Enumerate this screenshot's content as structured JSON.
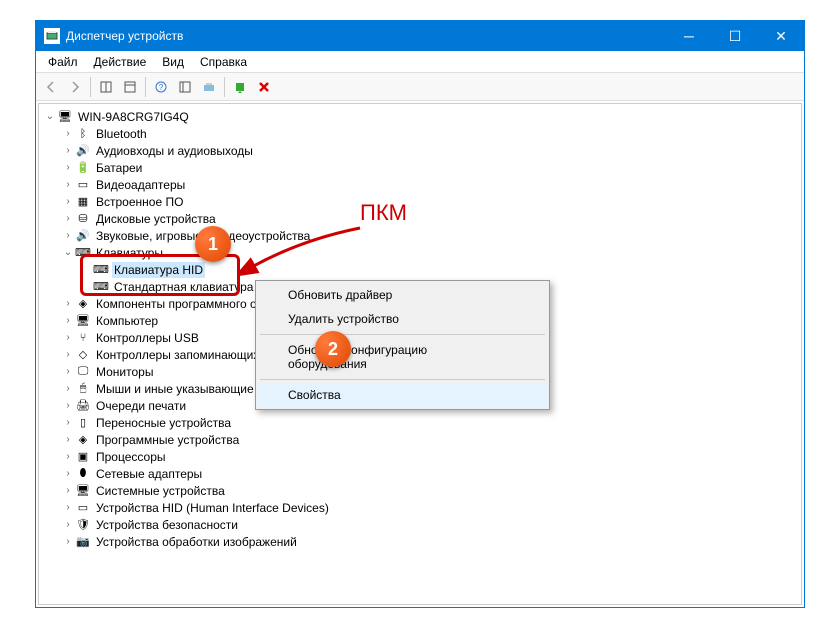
{
  "window": {
    "title": "Диспетчер устройств"
  },
  "menubar": {
    "file": "Файл",
    "action": "Действие",
    "view": "Вид",
    "help": "Справка"
  },
  "tree": {
    "root": "WIN-9A8CRG7IG4Q",
    "items": [
      "Bluetooth",
      "Аудиовходы и аудиовыходы",
      "Батареи",
      "Видеоадаптеры",
      "Встроенное ПО",
      "Дисковые устройства",
      "Звуковые, игровые и видеоустройства",
      "Клавиатуры",
      "Клавиатура HID",
      "Стандартная клавиатура",
      "Компоненты программного обеспечения",
      "Компьютер",
      "Контроллеры USB",
      "Контроллеры запоминающих устройств",
      "Мониторы",
      "Мыши и иные указывающие устройства",
      "Очереди печати",
      "Переносные устройства",
      "Программные устройства",
      "Процессоры",
      "Сетевые адаптеры",
      "Системные устройства",
      "Устройства HID (Human Interface Devices)",
      "Устройства безопасности",
      "Устройства обработки изображений"
    ]
  },
  "context_menu": {
    "update_driver": "Обновить драйвер",
    "uninstall": "Удалить устройство",
    "scan": "Обновить конфигурацию оборудования",
    "properties": "Свойства"
  },
  "annotation": {
    "rmb": "ПКМ",
    "badge1": "1",
    "badge2": "2"
  }
}
